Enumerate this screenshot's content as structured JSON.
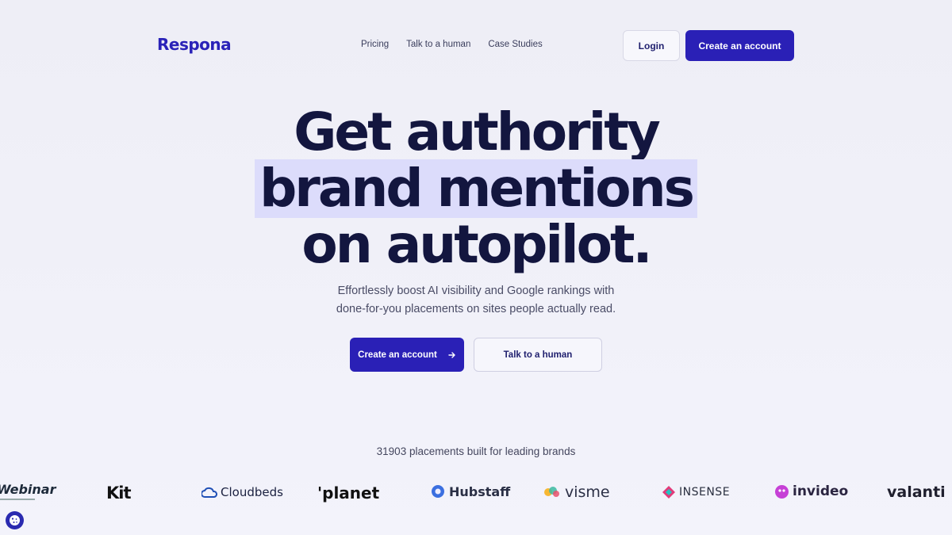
{
  "header": {
    "logo": "Respona",
    "nav": [
      "Pricing",
      "Talk to a human",
      "Case Studies"
    ],
    "login_label": "Login",
    "create_label": "Create an account"
  },
  "hero": {
    "line1": "Get authority",
    "line2": "brand mentions",
    "line3": "on autopilot.",
    "sub1": "Effortlessly boost AI visibility and Google rankings with",
    "sub2": "done-for-you placements on sites people actually read.",
    "cta_primary": "Create an account",
    "cta_primary_icon": "arrow-right-icon",
    "cta_secondary": "Talk to a human"
  },
  "brands": {
    "caption": "31903 placements built for leading brands",
    "logos": [
      "Webinar",
      "Kit",
      "Cloudbeds",
      "'planet",
      "Hubstaff",
      "visme",
      "INSENSE",
      "invideo",
      "valanti"
    ]
  },
  "colors": {
    "accent": "#2a20b6",
    "highlight": "#dcdcfb",
    "heading": "#13163f"
  },
  "cookie_icon": "cookie-icon"
}
